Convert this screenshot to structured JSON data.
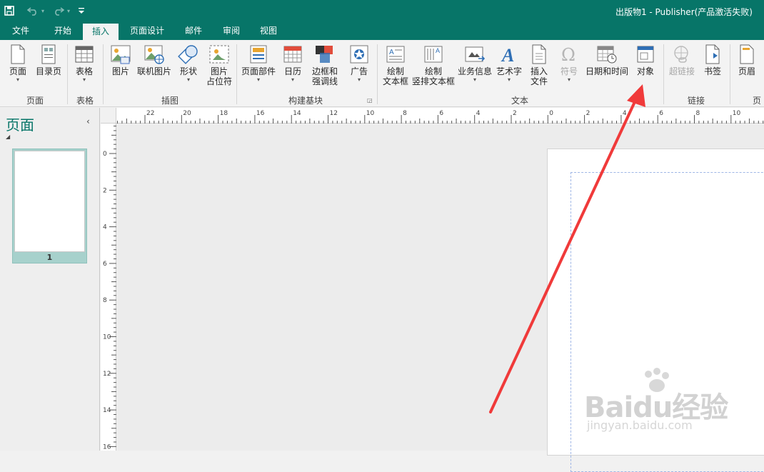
{
  "window": {
    "title": "出版物1 - Publisher(产品激活失败)",
    "qat": {
      "save_icon": "save-icon",
      "undo_icon": "undo-icon",
      "redo_icon": "redo-icon",
      "customize_icon": "customize-qat-icon"
    }
  },
  "tabs": [
    {
      "label": "文件"
    },
    {
      "label": "开始"
    },
    {
      "label": "插入"
    },
    {
      "label": "页面设计"
    },
    {
      "label": "邮件"
    },
    {
      "label": "审阅"
    },
    {
      "label": "视图"
    }
  ],
  "active_tab": "插入",
  "ribbon": {
    "buttons": {
      "page": "页面",
      "catalog_page": "目录页",
      "table": "表格",
      "picture": "图片",
      "online_picture": "联机图片",
      "shapes": "形状",
      "picture_placeholder_1": "图片",
      "picture_placeholder_2": "占位符",
      "page_parts": "页面部件",
      "calendar": "日历",
      "borders_1": "边框和",
      "borders_2": "强调线",
      "advertisement": "广告",
      "draw_textbox_1": "绘制",
      "draw_textbox_2": "文本框",
      "draw_vertical_1": "绘制",
      "draw_vertical_2": "竖排文本框",
      "business_info": "业务信息",
      "wordart": "艺术字",
      "insert_file_1": "插入",
      "insert_file_2": "文件",
      "symbol": "符号",
      "date_time": "日期和时间",
      "object": "对象",
      "hyperlink": "超链接",
      "bookmark": "书签",
      "header": "页眉"
    },
    "groups": {
      "pages": "页面",
      "tables": "表格",
      "illustrations": "插图",
      "building_blocks": "构建基块",
      "text": "文本",
      "links": "链接",
      "header_footer": "页"
    }
  },
  "pages_pane": {
    "title": "页面",
    "thumbnail_number": "1"
  },
  "rulers": {
    "horizontal_labels": [
      "22",
      "20",
      "18",
      "16",
      "14",
      "12",
      "10",
      "8",
      "6",
      "4",
      "2",
      "0",
      "2",
      "4",
      "6",
      "8",
      "10"
    ],
    "vertical_labels": [
      "0",
      "2",
      "4",
      "6",
      "8",
      "10",
      "12",
      "14",
      "16"
    ]
  },
  "watermark": {
    "brand": "Baidu经验",
    "url": "jingyan.baidu.com"
  },
  "annotation": {
    "color": "#f03a3a",
    "points_to": "object-button"
  }
}
